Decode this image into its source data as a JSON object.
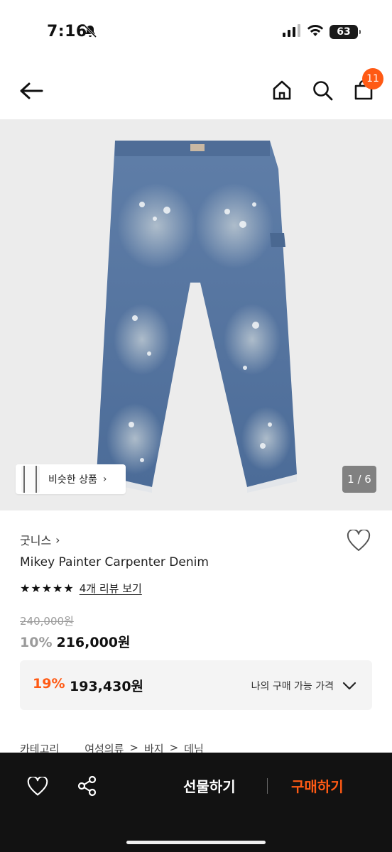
{
  "status_bar": {
    "time": "7:16",
    "battery": "63"
  },
  "nav": {
    "cart_count": "11"
  },
  "hero": {
    "similar_label": "비슷한 상품",
    "page_indicator": "1 / 6"
  },
  "product": {
    "brand": "굿니스",
    "name": "Mikey Painter Carpenter Denim",
    "rating": 5,
    "stars": "★★★★★",
    "review_link": "4개 리뷰 보기",
    "original_price": "240,000원",
    "discount_rate": "10%",
    "sale_price": "216,000원"
  },
  "my_price": {
    "rate": "19%",
    "price": "193,430원",
    "label": "나의 구매 가능 가격"
  },
  "category": {
    "label": "카테고리",
    "path": [
      "여성의류",
      ">",
      "바지",
      ">",
      "데님"
    ]
  },
  "bottom_bar": {
    "gift_label": "선물하기",
    "buy_label": "구매하기"
  },
  "colors": {
    "accent": "#ff5a14",
    "bottom_bar": "#121212",
    "hero_bg": "#ececec"
  }
}
